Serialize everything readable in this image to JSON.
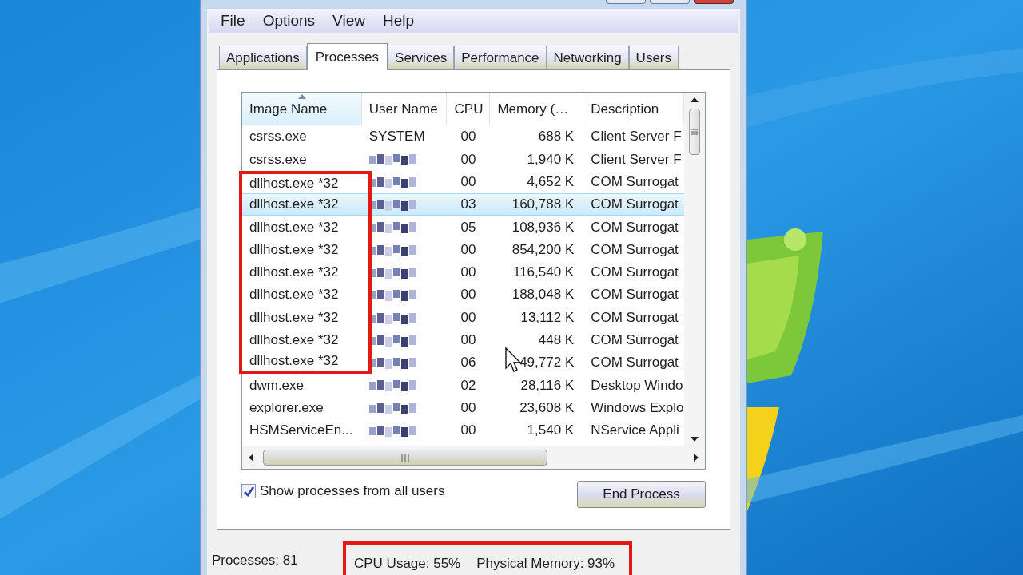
{
  "menu": [
    "File",
    "Options",
    "View",
    "Help"
  ],
  "tabs": [
    {
      "label": "Applications",
      "selected": false
    },
    {
      "label": "Processes",
      "selected": true
    },
    {
      "label": "Services",
      "selected": false
    },
    {
      "label": "Performance",
      "selected": false
    },
    {
      "label": "Networking",
      "selected": false
    },
    {
      "label": "Users",
      "selected": false
    }
  ],
  "table": {
    "columns": [
      {
        "label": "Image Name",
        "sorted": true
      },
      {
        "label": "User Name",
        "sorted": false
      },
      {
        "label": "CPU",
        "sorted": false
      },
      {
        "label": "Memory (…",
        "sorted": false
      },
      {
        "label": "Description",
        "sorted": false
      }
    ],
    "rows": [
      {
        "image": "csrss.exe",
        "user": "SYSTEM",
        "cpu": "00",
        "memory": "688 K",
        "description": "Client Server F",
        "selected": false,
        "highlighted": false
      },
      {
        "image": "csrss.exe",
        "cpu": "00",
        "memory": "1,940 K",
        "description": "Client Server F",
        "selected": false,
        "highlighted": false
      },
      {
        "image": "dllhost.exe *32",
        "cpu": "00",
        "memory": "4,652 K",
        "description": "COM Surrogat",
        "selected": false,
        "highlighted": true
      },
      {
        "image": "dllhost.exe *32",
        "cpu": "03",
        "memory": "160,788 K",
        "description": "COM Surrogat",
        "selected": true,
        "highlighted": true
      },
      {
        "image": "dllhost.exe *32",
        "cpu": "05",
        "memory": "108,936 K",
        "description": "COM Surrogat",
        "selected": false,
        "highlighted": true
      },
      {
        "image": "dllhost.exe *32",
        "cpu": "00",
        "memory": "854,200 K",
        "description": "COM Surrogat",
        "selected": false,
        "highlighted": true
      },
      {
        "image": "dllhost.exe *32",
        "cpu": "00",
        "memory": "116,540 K",
        "description": "COM Surrogat",
        "selected": false,
        "highlighted": true
      },
      {
        "image": "dllhost.exe *32",
        "cpu": "00",
        "memory": "188,048 K",
        "description": "COM Surrogat",
        "selected": false,
        "highlighted": true
      },
      {
        "image": "dllhost.exe *32",
        "cpu": "00",
        "memory": "13,112 K",
        "description": "COM Surrogat",
        "selected": false,
        "highlighted": true
      },
      {
        "image": "dllhost.exe *32",
        "cpu": "00",
        "memory": "448 K",
        "description": "COM Surrogat",
        "selected": false,
        "highlighted": true
      },
      {
        "image": "dllhost.exe *32",
        "cpu": "06",
        "memory": "49,772 K",
        "description": "COM Surrogat",
        "selected": false,
        "highlighted": true
      },
      {
        "image": "dwm.exe",
        "cpu": "02",
        "memory": "28,116 K",
        "description": "Desktop Windo",
        "selected": false,
        "highlighted": false
      },
      {
        "image": "explorer.exe",
        "cpu": "00",
        "memory": "23,608 K",
        "description": "Windows Explo",
        "selected": false,
        "highlighted": false
      },
      {
        "image": "HSMServiceEn...",
        "cpu": "00",
        "memory": "1,540 K",
        "description": "NService Appli",
        "selected": false,
        "highlighted": false
      }
    ]
  },
  "show_all_users": {
    "label": "Show processes from all users",
    "checked": true
  },
  "end_button": "End Process",
  "status_bar": [
    {
      "text": "Processes: 81",
      "highlighted": false
    },
    {
      "text": "CPU Usage: 55%",
      "highlighted": true
    },
    {
      "text": "Physical Memory: 93%",
      "highlighted": true
    }
  ]
}
